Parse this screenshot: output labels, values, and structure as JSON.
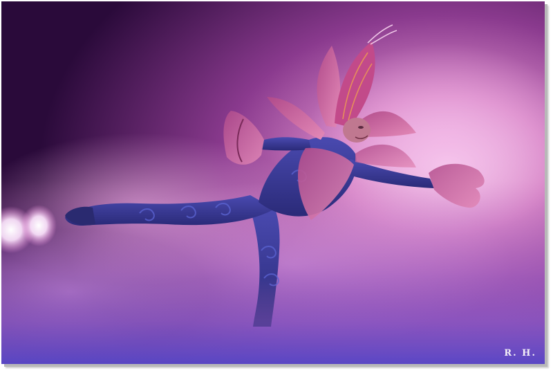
{
  "photo": {
    "subject": "ice-skater-in-flower-costume",
    "palette": {
      "deep_purple": "#2a0a3a",
      "magenta": "#c04a9a",
      "pink_glow": "#f2b8e6",
      "violet": "#6a4fc8",
      "costume_blue": "#3a3f9a",
      "petal_pink": "#d06a9e"
    }
  },
  "watermark": {
    "text": "R. H."
  }
}
